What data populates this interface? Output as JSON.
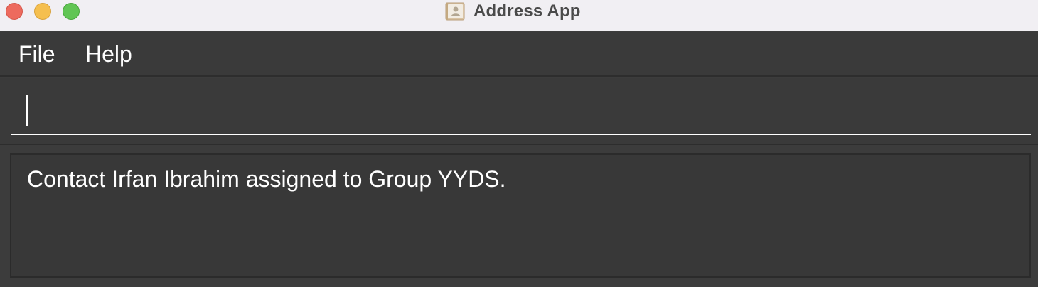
{
  "window": {
    "title": "Address App",
    "app_icon": "address-book-icon"
  },
  "menu": {
    "items": [
      {
        "label": "File"
      },
      {
        "label": "Help"
      }
    ]
  },
  "command_box": {
    "value": "",
    "placeholder": ""
  },
  "result_display": {
    "message": "Contact Irfan Ibrahim assigned to Group YYDS."
  },
  "colors": {
    "titlebar_bg": "#f1eff3",
    "app_bg": "#3a3a3a",
    "text": "#ffffff",
    "close": "#ed6a5e",
    "minimize": "#f5bf4f",
    "zoom": "#61c554"
  }
}
